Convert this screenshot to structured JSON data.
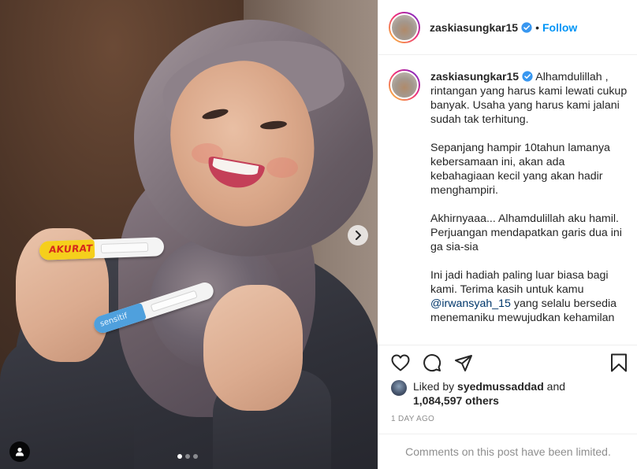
{
  "post": {
    "username": "zaskiasungkar15",
    "separator": "•",
    "follow_label": "Follow",
    "caption_paragraphs": [
      "Alhamdulillah ,\nrintangan yang harus kami lewati cukup banyak. Usaha yang harus kami jalani sudah tak terhitung.",
      "Sepanjang hampir 10tahun lamanya kebersamaan ini, akan ada kebahagiaan kecil yang akan hadir menghampiri.",
      "Akhirnyaaa... Alhamdulillah aku hamil.\nPerjuangan mendapatkan garis dua ini ga sia-sia",
      "Ini jadi hadiah paling luar biasa bagi kami. Terima kasih untuk kamu"
    ],
    "mention": "@irwansyah_15",
    "caption_tail": " yang selalu bersedia menemaniku mewujudkan kehamilan",
    "liked_by_prefix": "Liked by ",
    "liked_by_user": "syedmussaddad",
    "liked_by_and": " and",
    "others_count": "1,084,597 others",
    "time_ago": "1 DAY AGO",
    "comments_limited": "Comments on this post have been limited.",
    "carousel": {
      "total": 3,
      "current": 1
    }
  },
  "photo": {
    "test_yellow_label": "AKURAT",
    "test_blue_label": "sensitif"
  },
  "colors": {
    "accent": "#0095f6",
    "verified": "#3897f0",
    "muted": "#8e8e8e",
    "text": "#262626"
  },
  "icons": {
    "verified": "verified-badge-icon",
    "like": "heart-icon",
    "comment": "comment-bubble-icon",
    "share": "paper-plane-icon",
    "save": "bookmark-icon",
    "next": "chevron-right-icon",
    "tags": "user-icon"
  }
}
